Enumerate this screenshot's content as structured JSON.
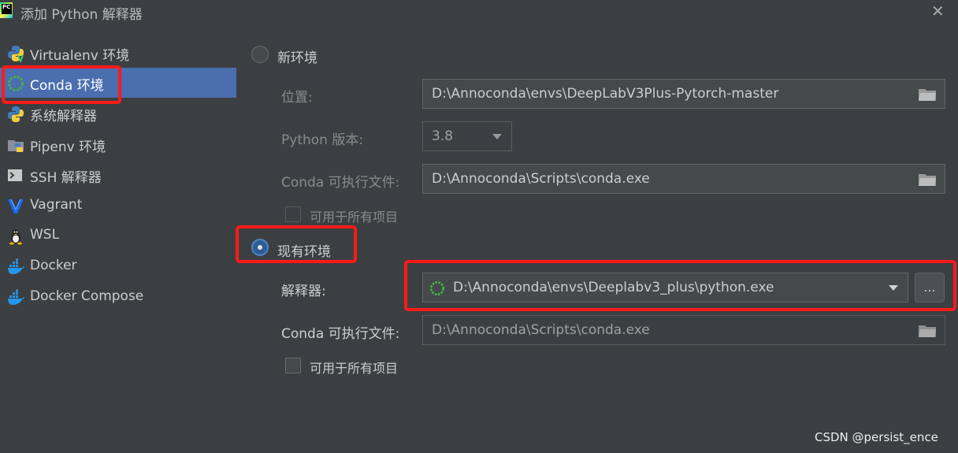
{
  "window": {
    "title": "添加 Python 解释器",
    "close_glyph": "✕"
  },
  "sidebar": {
    "items": [
      {
        "label": "Virtualenv 环境",
        "icon": "python-icon"
      },
      {
        "label": "Conda 环境",
        "icon": "conda-icon",
        "selected": true
      },
      {
        "label": "系统解释器",
        "icon": "python-icon"
      },
      {
        "label": "Pipenv 环境",
        "icon": "pipenv-icon"
      },
      {
        "label": "SSH 解释器",
        "icon": "terminal-icon"
      },
      {
        "label": "Vagrant",
        "icon": "vagrant-icon"
      },
      {
        "label": "WSL",
        "icon": "linux-icon"
      },
      {
        "label": "Docker",
        "icon": "docker-icon"
      },
      {
        "label": "Docker Compose",
        "icon": "docker-icon"
      }
    ]
  },
  "new_env": {
    "radio_label": "新环境",
    "location_label": "位置:",
    "location_value": "D:\\Annoconda\\envs\\DeepLabV3Plus-Pytorch-master",
    "python_version_label": "Python 版本:",
    "python_version_value": "3.8",
    "conda_exe_label": "Conda 可执行文件:",
    "conda_exe_value": "D:\\Annoconda\\Scripts\\conda.exe",
    "all_projects_label": "可用于所有项目"
  },
  "existing_env": {
    "radio_label": "现有环境",
    "interpreter_label": "解释器:",
    "interpreter_value": "D:\\Annoconda\\envs\\Deeplabv3_plus\\python.exe",
    "browse_label": "...",
    "conda_exe_label": "Conda 可执行文件:",
    "conda_exe_value": "D:\\Annoconda\\Scripts\\conda.exe",
    "all_projects_label": "可用于所有项目"
  },
  "watermark": "CSDN @persist_ence",
  "colors": {
    "selection": "#4b6eaf",
    "highlight_box": "#ff1a1a",
    "background": "#3c3f41"
  }
}
